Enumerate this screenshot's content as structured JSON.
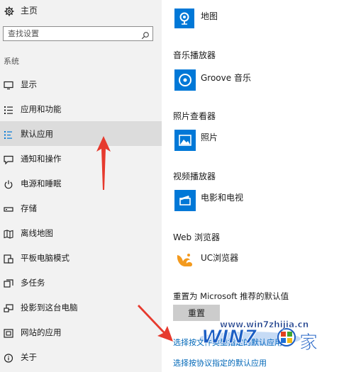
{
  "sidebar": {
    "home_label": "主页",
    "search_placeholder": "查找设置",
    "section_title": "系统",
    "items": [
      {
        "label": "显示",
        "icon": "display-icon"
      },
      {
        "label": "应用和功能",
        "icon": "apps-list-icon"
      },
      {
        "label": "默认应用",
        "icon": "default-apps-icon",
        "selected": true
      },
      {
        "label": "通知和操作",
        "icon": "notification-icon"
      },
      {
        "label": "电源和睡眠",
        "icon": "power-icon"
      },
      {
        "label": "存储",
        "icon": "storage-icon"
      },
      {
        "label": "离线地图",
        "icon": "map-icon"
      },
      {
        "label": "平板电脑模式",
        "icon": "tablet-icon"
      },
      {
        "label": "多任务",
        "icon": "multitask-icon"
      },
      {
        "label": "投影到这台电脑",
        "icon": "project-icon"
      },
      {
        "label": "网站的应用",
        "icon": "web-apps-icon"
      },
      {
        "label": "关于",
        "icon": "info-icon"
      }
    ]
  },
  "main": {
    "map_app": "地图",
    "music": {
      "title": "音乐播放器",
      "app": "Groove 音乐"
    },
    "photo": {
      "title": "照片查看器",
      "app": "照片"
    },
    "video": {
      "title": "视频播放器",
      "app": "电影和电视"
    },
    "browser": {
      "title": "Web 浏览器",
      "app": "UC浏览器"
    },
    "reset": {
      "title": "重置为 Microsoft 推荐的默认值",
      "button": "重置"
    },
    "links": [
      "选择按文件类型指定的默认应用",
      "选择按协议指定的默认应用"
    ]
  },
  "watermark": {
    "site": "www.win7zhijia.cn",
    "logo_text": "WIN7",
    "char": "家"
  },
  "colors": {
    "accent": "#0078d7",
    "link": "#0067b8",
    "arrow": "#e63a2e",
    "uc_orange": "#f39a1e"
  }
}
